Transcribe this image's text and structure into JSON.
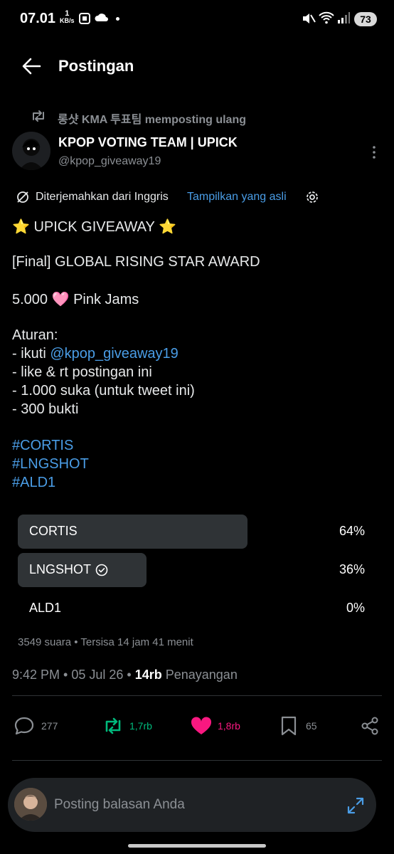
{
  "status_bar": {
    "time": "07.01",
    "speed_value": "1",
    "speed_unit": "KB/s",
    "battery": "73"
  },
  "header": {
    "title": "Postingan"
  },
  "repost": {
    "text": "롱샷 KMA 투표팀 memposting ulang"
  },
  "author": {
    "name": "KPOP VOTING TEAM | UPICK",
    "handle": "@kpop_giveaway19"
  },
  "translation": {
    "label": "Diterjemahkan dari Inggris",
    "show_original": "Tampilkan yang asli"
  },
  "post": {
    "line1": "⭐ UPICK GIVEAWAY ⭐",
    "line2": "[Final] GLOBAL RISING STAR AWARD",
    "line3": "5.000 🩷 Pink Jams",
    "rules_title": "Aturan:",
    "rule1_prefix": "- ikuti ",
    "rule1_link": "@kpop_giveaway19",
    "rule2": "- like & rt postingan ini",
    "rule3": "- 1.000 suka (untuk tweet ini)",
    "rule4": "- 300 bukti",
    "hashtags": [
      "#CORTIS",
      "#LNGSHOT",
      "#ALD1"
    ]
  },
  "poll": {
    "options": [
      {
        "label": "CORTIS",
        "percent": "64%",
        "value": 0.64
      },
      {
        "label": "LNGSHOT",
        "percent": "36%",
        "value": 0.36,
        "selected": true
      },
      {
        "label": "ALD1",
        "percent": "0%",
        "value": 0
      }
    ],
    "meta": "3549 suara • Tersisa 14 jam 41 menit"
  },
  "meta": {
    "time_date": "9:42 PM • 05 Jul 26 • ",
    "views_count": "14rb",
    "views_label": " Penayangan"
  },
  "actions": {
    "replies": "277",
    "reposts": "1,7rb",
    "likes": "1,8rb",
    "bookmarks": "65",
    "colors": {
      "repost": "#00ba7c",
      "like": "#f91880",
      "default": "#8b8f94"
    }
  },
  "reply": {
    "placeholder": "Posting balasan Anda"
  }
}
